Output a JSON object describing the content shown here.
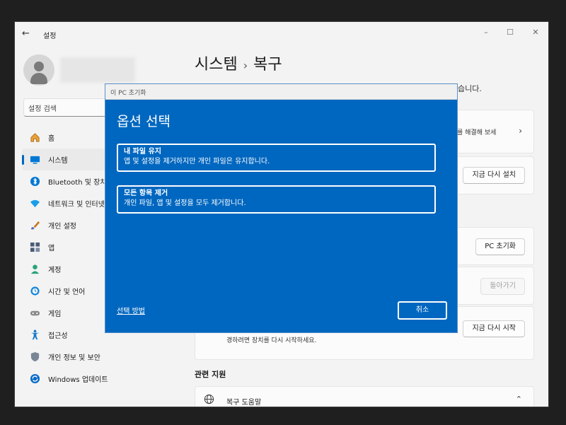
{
  "window": {
    "back_icon": "back-arrow-icon",
    "title": "설정",
    "controls": {
      "minimize": "–",
      "maximize": "☐",
      "close": "✕"
    }
  },
  "sidebar": {
    "search_placeholder": "설정 검색",
    "items": [
      {
        "label": "홈",
        "icon": "home-icon",
        "active": false
      },
      {
        "label": "시스템",
        "icon": "system-icon",
        "active": true
      },
      {
        "label": "Bluetooth 및 장치",
        "icon": "bluetooth-icon",
        "active": false
      },
      {
        "label": "네트워크 및 인터넷",
        "icon": "network-icon",
        "active": false
      },
      {
        "label": "개인 설정",
        "icon": "brush-icon",
        "active": false
      },
      {
        "label": "앱",
        "icon": "apps-icon",
        "active": false
      },
      {
        "label": "계정",
        "icon": "account-icon",
        "active": false
      },
      {
        "label": "시간 및 언어",
        "icon": "clock-globe-icon",
        "active": false
      },
      {
        "label": "게임",
        "icon": "gamepad-icon",
        "active": false
      },
      {
        "label": "접근성",
        "icon": "accessibility-icon",
        "active": false
      },
      {
        "label": "개인 정보 및 보안",
        "icon": "shield-icon",
        "active": false
      },
      {
        "label": "Windows 업데이트",
        "icon": "update-icon",
        "active": false
      }
    ]
  },
  "main": {
    "breadcrumb": {
      "parent": "시스템",
      "separator": "›",
      "current": "복구"
    },
    "subtitle_tail": "습니다.",
    "fix_tail": "를 해결해 보세",
    "reinstall_button": "지금 다시 설치",
    "reset_button": "PC 초기화",
    "goback_button": "돌아가기",
    "restart_button": "지금 다시 시작",
    "restart_desc_tail": "경하려면 장치를 다시 시작하세요.",
    "related_title": "관련 지원",
    "help_label": "복구 도움말"
  },
  "dialog": {
    "title": "이 PC 초기화",
    "heading": "옵션 선택",
    "options": [
      {
        "title": "내 파일 유지",
        "desc": "앱 및 설정을 제거하지만 개인 파일은 유지합니다."
      },
      {
        "title": "모든 항목 제거",
        "desc": "개인 파일, 앱 및 설정을 모두 제거합니다."
      }
    ],
    "how_link": "선택 방법",
    "cancel": "취소"
  },
  "colors": {
    "accent": "#0067c0",
    "window_bg": "#f3f3f3",
    "card_bg": "#fbfbfb"
  }
}
